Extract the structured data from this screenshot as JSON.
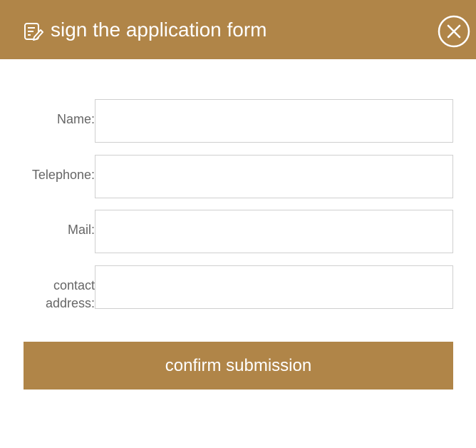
{
  "header": {
    "title": "sign the application form",
    "icon": "edit-form-icon",
    "close_icon": "close-circle-icon",
    "background_color": "#b08548"
  },
  "form": {
    "fields": [
      {
        "label": "Name:",
        "value": "",
        "placeholder": ""
      },
      {
        "label": "Telephone:",
        "value": "",
        "placeholder": ""
      },
      {
        "label": "Mail:",
        "value": "",
        "placeholder": ""
      },
      {
        "label_line1": "contact",
        "label_line2": "address:",
        "value": "",
        "placeholder": ""
      }
    ],
    "submit_label": "confirm submission",
    "button_color": "#b08548"
  }
}
